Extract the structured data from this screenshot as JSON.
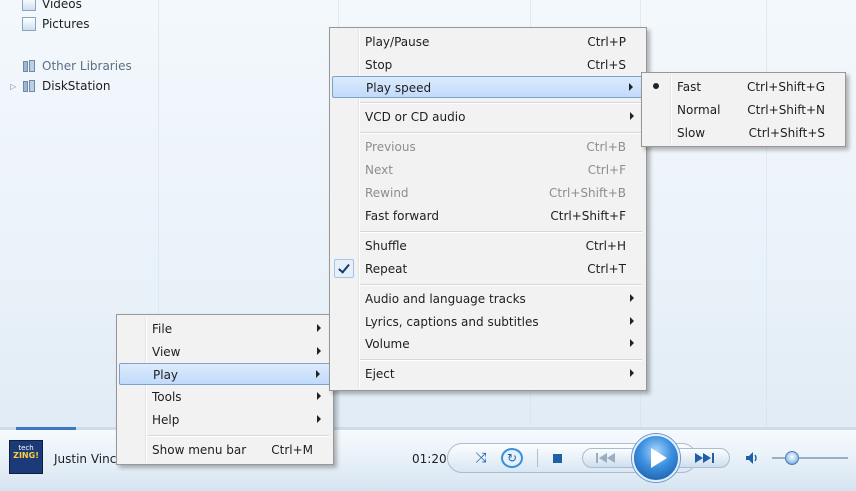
{
  "library": {
    "items": [
      {
        "label": "Videos"
      },
      {
        "label": "Pictures"
      },
      {
        "label": "Other Libraries"
      },
      {
        "label": "DiskStation"
      }
    ]
  },
  "context_menu": {
    "items": [
      {
        "label": "File"
      },
      {
        "label": "View"
      },
      {
        "label": "Play"
      },
      {
        "label": "Tools"
      },
      {
        "label": "Help"
      },
      {
        "label": "Show menu bar",
        "shortcut": "Ctrl+M"
      }
    ],
    "highlighted": "Play"
  },
  "play_menu": {
    "items": [
      {
        "label": "Play/Pause",
        "shortcut": "Ctrl+P"
      },
      {
        "label": "Stop",
        "shortcut": "Ctrl+S"
      },
      {
        "label": "Play speed"
      },
      {
        "label": "VCD or CD audio"
      },
      {
        "label": "Previous",
        "shortcut": "Ctrl+B",
        "disabled": true
      },
      {
        "label": "Next",
        "shortcut": "Ctrl+F",
        "disabled": true
      },
      {
        "label": "Rewind",
        "shortcut": "Ctrl+Shift+B",
        "disabled": true
      },
      {
        "label": "Fast forward",
        "shortcut": "Ctrl+Shift+F"
      },
      {
        "label": "Shuffle",
        "shortcut": "Ctrl+H"
      },
      {
        "label": "Repeat",
        "shortcut": "Ctrl+T",
        "checked": true
      },
      {
        "label": "Audio and language tracks"
      },
      {
        "label": "Lyrics, captions and subtitles"
      },
      {
        "label": "Volume"
      },
      {
        "label": "Eject"
      }
    ],
    "highlighted": "Play speed"
  },
  "speed_menu": {
    "items": [
      {
        "label": "Fast",
        "shortcut": "Ctrl+Shift+G",
        "selected": true
      },
      {
        "label": "Normal",
        "shortcut": "Ctrl+Shift+N"
      },
      {
        "label": "Slow",
        "shortcut": "Ctrl+Shift+S"
      }
    ]
  },
  "player": {
    "now_playing": "Justin Vinco",
    "time": "01:20",
    "album_art_text": {
      "top": "tech",
      "brand": "ZING!"
    },
    "icons": {
      "shuffle": "shuffle-icon",
      "repeat": "repeat-icon",
      "stop": "stop-icon",
      "previous": "previous-icon",
      "play": "play-icon",
      "next": "next-icon",
      "volume": "volume-icon"
    },
    "accent_color": "#3a8ede"
  }
}
